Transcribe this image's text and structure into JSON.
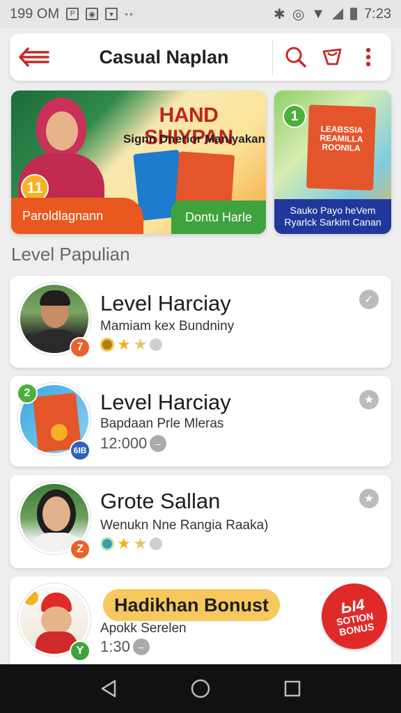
{
  "status_bar": {
    "left_text": "199 OM",
    "time": "7:23"
  },
  "app_bar": {
    "title": "Casual Naplan",
    "icons": [
      "back-menu-icon",
      "search-icon",
      "shop-bag-icon",
      "more-vert-icon"
    ]
  },
  "banners": [
    {
      "headline": "HAND SHIYPAN",
      "subline": "Signn Dnerior Maniyakan",
      "badge_number": "11",
      "left_ribbon": "Paroldlagnann",
      "right_ribbon": "Dontu Harle"
    },
    {
      "badge_number": "1",
      "pack_text": "LEABSSIA REAMILLA ROONILA",
      "footer_text": "Sauko Payo heVem Ryarlck Sarkim Canan"
    }
  ],
  "section": {
    "title": "Level Papulian"
  },
  "cards": [
    {
      "name": "Level Harciay",
      "sub": "Mamiam kex Bundniny",
      "level_badge": "7",
      "level_color": "#e8622b",
      "status_icon": "check-icon"
    },
    {
      "name": "Level Harciay",
      "sub": "Bapdaan Prle Mleras",
      "corner_badge": "2",
      "level_badge": "6IB",
      "level_color": "#2a63b8",
      "time": "12:000",
      "status_icon": "star-badge-icon"
    },
    {
      "name": "Grote Sallan",
      "sub": "Wenukn Nne Rangia Raaka)",
      "level_badge": "Z",
      "level_color": "#e8622b",
      "status_icon": "star-badge-icon"
    },
    {
      "name": "Hadikhan Bonust",
      "sub": "Apokk Serelen",
      "time": "1:30",
      "level_badge": "Y",
      "level_color": "#3fa33d",
      "bonus_badge_big": "Ы4",
      "bonus_badge_line1": "SOTION",
      "bonus_badge_line2": "BONUS"
    }
  ]
}
